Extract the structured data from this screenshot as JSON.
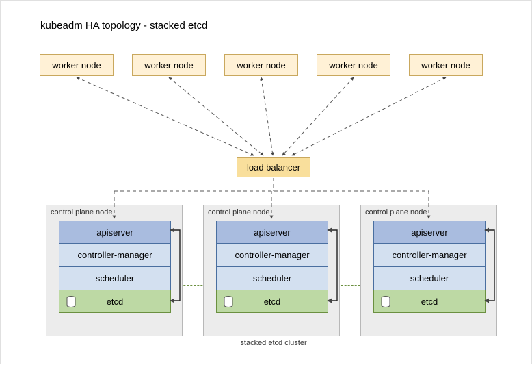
{
  "title": "kubeadm HA topology - stacked etcd",
  "worker_label": "worker node",
  "workers_x": [
    57,
    192,
    327,
    462,
    597
  ],
  "load_balancer_label": "load balancer",
  "control_plane_label": "control plane node",
  "control_planes_x": [
    66,
    296,
    526
  ],
  "components": {
    "apiserver": "apiserver",
    "controller_manager": "controller-manager",
    "scheduler": "scheduler",
    "etcd": "etcd"
  },
  "etcd_cluster_label": "stacked etcd cluster",
  "colors": {
    "worker_bg": "#fff1d6",
    "lb_bg": "#f9df9c",
    "cp_bg": "#ececec",
    "apiserver_bg": "#a9bcdf",
    "cm_bg": "#d3e0f0",
    "etcd_bg": "#bdd9a4"
  }
}
